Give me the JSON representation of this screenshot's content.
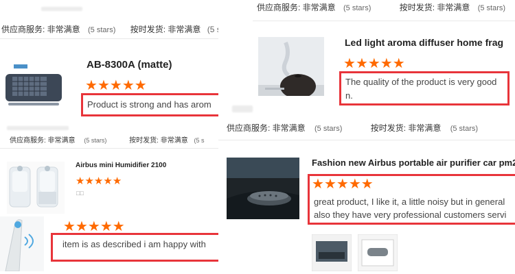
{
  "colors": {
    "star": "#ff6a00",
    "highlight_border": "#e8343a"
  },
  "service_label": "供应商服务: 非常满意",
  "delivery_label": "按时发货: 非常满意",
  "rating_text": "(5 stars)",
  "rating_stars": 5,
  "star_glyph": "★",
  "products": {
    "ab8300a": {
      "title": "AB-8300A (matte)",
      "review": "Product is strong and has arom"
    },
    "mini_humidifier": {
      "title": "Airbus mini Humidifier 2100",
      "subtext": "□□"
    },
    "pen_device": {
      "review": "item is as described i am happy with"
    },
    "aroma_diffuser": {
      "title": "Led light aroma diffuser home frag",
      "review_line1": "The quality of the product is very good",
      "review_line2": "n."
    },
    "car_purifier": {
      "title": "Fashion new Airbus portable air purifier car pm2",
      "review_line1": "great product, I like it, a little noisy but in general",
      "review_line2": "also they have very professional customers servi"
    }
  },
  "icons": {
    "star": "star-icon"
  }
}
